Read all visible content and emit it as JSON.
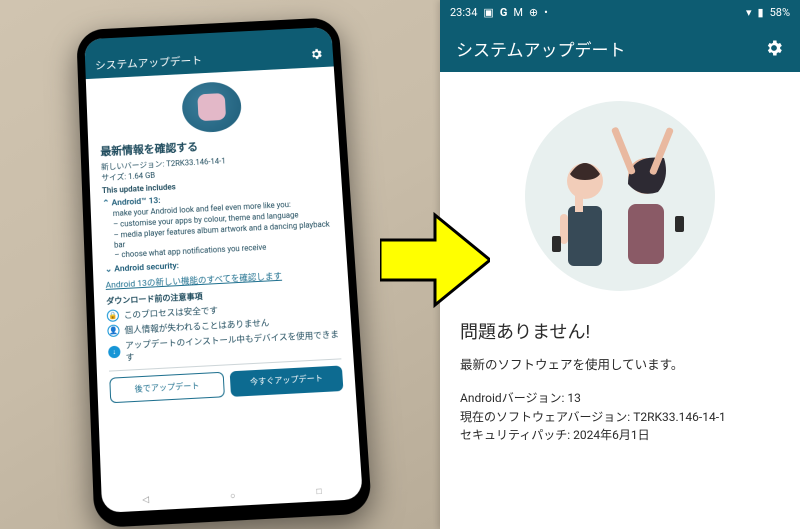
{
  "left": {
    "header": {
      "title": "システムアップデート"
    },
    "heading": "最新情報を確認する",
    "version_label": "新しいバージョン:",
    "version_value": "T2RK33.146-14-1",
    "size_label": "サイズ:",
    "size_value": "1.64 GB",
    "includes_label": "This update includes",
    "feature_android_title": "Android™ 13:",
    "feature_android_sub": "make your Android look and feel even more like you:",
    "feature_bullets": [
      "– customise your apps by colour, theme and language",
      "– media player features album artwork and a dancing playback bar",
      "– choose what app notifications you receive"
    ],
    "feature_security_title": "Android security:",
    "link_text": "Android 13の新しい機能のすべてを確認します",
    "notes_title": "ダウンロード前の注意事項",
    "notes": [
      {
        "icon": "lock",
        "text": "このプロセスは安全です"
      },
      {
        "icon": "user",
        "text": "個人情報が失われることはありません"
      },
      {
        "icon": "down",
        "text": "アップデートのインストール中もデバイスを使用できます"
      }
    ],
    "btn_later": "後でアップデート",
    "btn_now": "今すぐアップデート"
  },
  "right": {
    "status": {
      "time": "23:34",
      "battery": "58%"
    },
    "header": {
      "title": "システムアップデート"
    },
    "heading": "問題ありません!",
    "subtext": "最新のソフトウェアを使用しています。",
    "rows": {
      "android_label": "Androidバージョン:",
      "android_value": "13",
      "sw_label": "現在のソフトウェアバージョン:",
      "sw_value": "T2RK33.146-14-1",
      "patch_label": "セキュリティパッチ:",
      "patch_value": "2024年6月1日"
    }
  }
}
